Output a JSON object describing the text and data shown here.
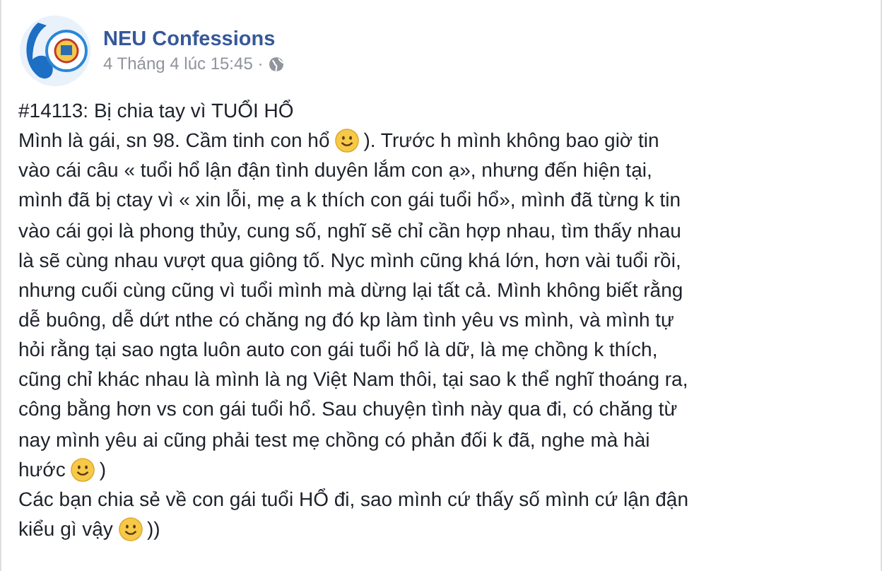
{
  "post": {
    "author": "NEU Confessions",
    "timestamp": "4 Tháng 4 lúc 15:45 ·",
    "lines": [
      [
        {
          "kind": "text",
          "text": "#14113: Bị chia tay vì TUỔI HỔ"
        }
      ],
      [
        {
          "kind": "text",
          "text": "Mình là gái, sn 98. Cầm tinh con hổ"
        },
        {
          "kind": "emoji"
        },
        {
          "kind": "text",
          "text": "). Trước h mình không bao giờ tin"
        }
      ],
      [
        {
          "kind": "text",
          "text": "vào cái câu « tuổi hổ lận đận tình duyên lắm con ạ», nhưng đến hiện tại,"
        }
      ],
      [
        {
          "kind": "text",
          "text": "mình đã bị ctay vì « xin lỗi, mẹ a k thích con gái tuổi hổ», mình đã từng k tin"
        }
      ],
      [
        {
          "kind": "text",
          "text": "vào cái gọi là phong thủy, cung số, nghĩ sẽ chỉ cần hợp nhau, tìm thấy nhau"
        }
      ],
      [
        {
          "kind": "text",
          "text": "là sẽ cùng nhau vượt qua giông tố. Nyc mình cũng khá lớn, hơn vài tuổi rồi,"
        }
      ],
      [
        {
          "kind": "text",
          "text": "nhưng cuối cùng cũng vì tuổi mình mà dừng lại tất cả. Mình không biết rằng"
        }
      ],
      [
        {
          "kind": "text",
          "text": "dễ buông, dễ dứt nthe có chăng ng đó kp làm tình yêu vs mình, và mình tự"
        }
      ],
      [
        {
          "kind": "text",
          "text": "hỏi rằng tại sao ngta luôn auto con gái tuổi hổ là dữ, là mẹ chồng k thích,"
        }
      ],
      [
        {
          "kind": "text",
          "text": "cũng chỉ khác nhau là mình là ng Việt Nam thôi, tại sao k thể nghĩ thoáng ra,"
        }
      ],
      [
        {
          "kind": "text",
          "text": "công bằng hơn vs con gái tuổi hổ. Sau chuyện tình này qua đi, có chăng từ"
        }
      ],
      [
        {
          "kind": "text",
          "text": "nay mình yêu ai cũng phải test mẹ chồng có phản đối k đã, nghe mà hài"
        }
      ],
      [
        {
          "kind": "text",
          "text": "hước"
        },
        {
          "kind": "emoji"
        },
        {
          "kind": "text",
          "text": ")"
        }
      ],
      [
        {
          "kind": "text",
          "text": "Các bạn chia sẻ về con gái tuổi HỔ đi, sao mình cứ thấy số mình cứ lận đận"
        }
      ],
      [
        {
          "kind": "text",
          "text": "kiểu gì vậy"
        },
        {
          "kind": "emoji"
        },
        {
          "kind": "text",
          "text": "))"
        }
      ]
    ]
  }
}
